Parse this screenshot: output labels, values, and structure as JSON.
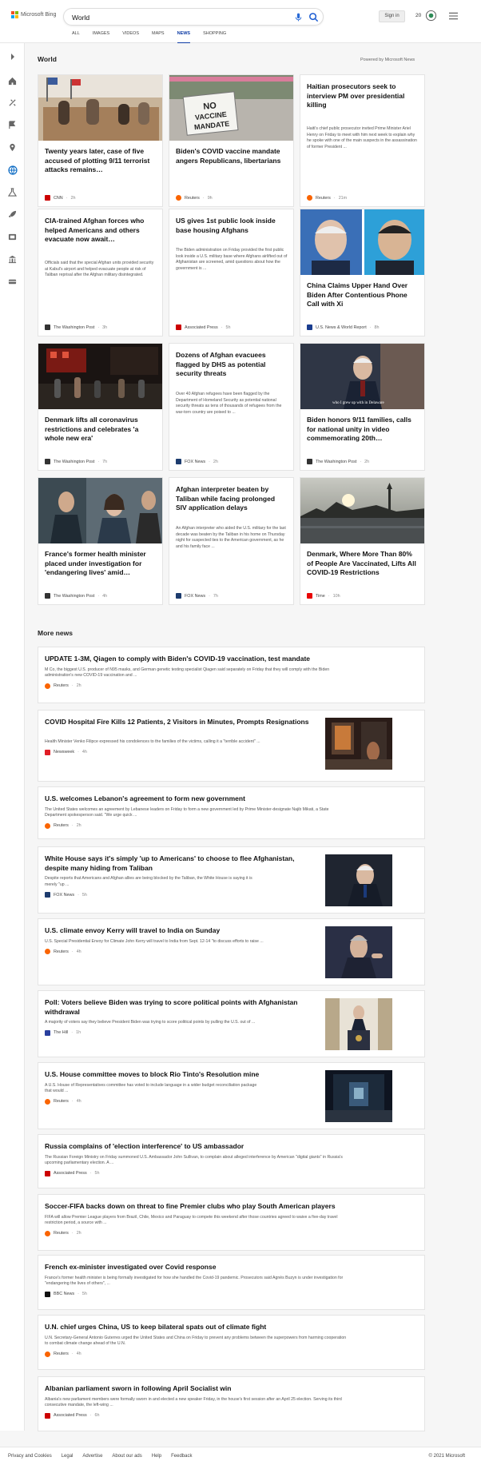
{
  "header": {
    "logo": "Microsoft Bing",
    "search_value": "World",
    "signin": "Sign in",
    "points": "20"
  },
  "nav": [
    "ALL",
    "IMAGES",
    "VIDEOS",
    "MAPS",
    "NEWS",
    "SHOPPING"
  ],
  "section_title": "World",
  "powered_by": "Powered by Microsoft News",
  "cards": [
    {
      "title": "Twenty years later, case of five accused of plotting 9/11 terrorist attacks remains…",
      "source": "CNN",
      "time": "2h",
      "logo_color": "#cc0000"
    },
    {
      "title": "Biden's COVID vaccine mandate angers Republicans, libertarians",
      "source": "Reuters",
      "time": "9h",
      "logo_color": "#fa6400"
    },
    {
      "title": "Haitian prosecutors seek to interview PM over presidential killing",
      "abstract": "Haiti's chief public prosecutor invited Prime Minister Ariel Henry on Friday to meet with him next week to explain why he spoke with one of the main suspects in the assassination of former President ...",
      "source": "Reuters",
      "time": "21m",
      "logo_color": "#fa6400"
    },
    {
      "title": "CIA-trained Afghan forces who helped Americans and others evacuate now await…",
      "abstract": "Officials said that the special Afghan units provided security at Kabul's airport and helped evacuate people at risk of Taliban reprisal after the Afghan military disintegrated.",
      "source": "The Washington Post",
      "time": "3h",
      "logo_color": "#333333"
    },
    {
      "title": "US gives 1st public look inside base housing Afghans",
      "abstract": "The Biden administration on Friday provided the first public look inside a U.S. military base where Afghans airlifted out of Afghanistan are screened, amid questions about how the government is ...",
      "source": "Associated Press",
      "time": "5h",
      "logo_color": "#cc0000"
    },
    {
      "title": "China Claims Upper Hand Over Biden After Contentious Phone Call with Xi",
      "source": "U.S. News & World Report",
      "time": "8h",
      "logo_color": "#1a3d8f"
    },
    {
      "title": "Denmark lifts all coronavirus restrictions and celebrates 'a whole new era'",
      "source": "The Washington Post",
      "time": "7h",
      "logo_color": "#333333"
    },
    {
      "title": "Dozens of Afghan evacuees flagged by DHS as potential security threats",
      "abstract": "Over 40 Afghan refugees have been flagged by the Department of Homeland Security as potential national security threats as tens of thousands of refugees from the war-torn country are poised to ...",
      "source": "FOX News",
      "time": "2h",
      "logo_color": "#1d3c6e"
    },
    {
      "title": "Biden honors 9/11 families, calls for national unity in video commemorating 20th…",
      "photo_caption": "who I grew up with in Delaware",
      "source": "The Washington Post",
      "time": "2h",
      "logo_color": "#333333"
    },
    {
      "title": "France's former health minister placed under investigation for 'endangering lives' amid…",
      "source": "The Washington Post",
      "time": "4h",
      "logo_color": "#333333"
    },
    {
      "title": "Afghan interpreter beaten by Taliban while facing prolonged SIV application delays",
      "abstract": "An Afghan interpreter who aided the U.S. military for the last decade was beaten by the Taliban in his home on Thursday night for suspected ties to the American government, as he and his family face ...",
      "source": "FOX News",
      "time": "7h",
      "logo_color": "#1d3c6e"
    },
    {
      "title": "Denmark, Where More Than 80% of People Are Vaccinated, Lifts All COVID-19 Restrictions",
      "source": "Time",
      "time": "10h",
      "logo_color": "#e90606"
    }
  ],
  "more_news_title": "More news",
  "more_news": [
    {
      "title": "UPDATE 1-3M, Qiagen to comply with Biden's COVID-19 vaccination, test mandate",
      "abstract": [
        "M Co, the biggest U.S. producer of N95 masks, and German genetic testing specialist Qiagen said separately on Friday that they will comply with the Biden",
        "administration's new COVID-19 vaccination and ..."
      ],
      "source": "Reuters",
      "time": "2h",
      "logo_color": "#fa6400"
    },
    {
      "title": "COVID Hospital Fire Kills 12 Patients, 2 Visitors in Minutes, Prompts Resignations",
      "abstract": [
        "Health Minister Venko Filipce expressed his condolences to the families of the victims, calling it a \"terrible accident\" ..."
      ],
      "source": "Newsweek",
      "time": "4h",
      "logo_color": "#e01e26"
    },
    {
      "title": "U.S. welcomes Lebanon's agreement to form new government",
      "abstract": [
        "The United States welcomes an agreement by Lebanese leaders on Friday to form a new government led by Prime Minister-designate Najib Mikati, a State",
        "Department spokesperson said. \"We urge quick ..."
      ],
      "source": "Reuters",
      "time": "2h",
      "logo_color": "#fa6400"
    },
    {
      "title": "White House says it's simply 'up to Americans' to choose to flee Afghanistan, despite many hiding from Taliban",
      "abstract": [
        "Despite reports that Americans and Afghan allies are being blocked by the Taliban, the White House is saying it is",
        "merely \"up ..."
      ],
      "source": "FOX News",
      "time": "5h",
      "logo_color": "#1d3c6e"
    },
    {
      "title": "U.S. climate envoy Kerry will travel to India on Sunday",
      "abstract": [
        "U.S. Special Presidential Envoy for Climate John Kerry will travel to India from Sept. 12-14 \"to discuss efforts to raise ..."
      ],
      "source": "Reuters",
      "time": "4h",
      "logo_color": "#fa6400"
    },
    {
      "title": "Poll: Voters believe Biden was trying to score political points with Afghanistan withdrawal",
      "abstract": [
        "A majority of voters say they believe President Biden was trying to score political points by pulling the U.S. out of ..."
      ],
      "source": "The Hill",
      "time": "1h",
      "logo_color": "#2a3f9e"
    },
    {
      "title": "U.S. House committee moves to block Rio Tinto's Resolution mine",
      "abstract": [
        "A U.S. House of Representatives committee has voted to include language in a wider budget reconciliation package",
        "that would ..."
      ],
      "source": "Reuters",
      "time": "4h",
      "logo_color": "#fa6400"
    },
    {
      "title": "Russia complains of 'election interference' to US ambassador",
      "abstract": [
        "The Russian Foreign Ministry on Friday summoned U.S. Ambassador John Sullivan, to complain about alleged interference by American \"digital giants\" in Russia's",
        "upcoming parliamentary election. A ..."
      ],
      "source": "Associated Press",
      "time": "5h",
      "logo_color": "#cc0000"
    },
    {
      "title": "Soccer-FIFA backs down on threat to fine Premier clubs who play South American players",
      "abstract": [
        "FIFA will allow Premier League players from Brazil, Chile, Mexico and Paraguay to compete this weekend after those countries agreed to waive a five-day travel",
        "restriction period, a source with ..."
      ],
      "source": "Reuters",
      "time": "2h",
      "logo_color": "#fa6400"
    },
    {
      "title": "French ex-minister investigated over Covid response",
      "abstract": [
        "France's former health minister is being formally investigated for how she handled the Covid-19 pandemic. Prosecutors said Agnès Buzyn is under investigation for",
        "\"endangering the lives of others\", ..."
      ],
      "source": "BBC News",
      "time": "5h",
      "logo_color": "#111111"
    },
    {
      "title": "U.N. chief urges China, US to keep bilateral spats out of climate fight",
      "abstract": [
        "U.N. Secretary-General Antonio Guterres urged the United States and China on Friday to prevent any problems between the superpowers from harming cooperation",
        "to combat climate change ahead of the U.N."
      ],
      "source": "Reuters",
      "time": "4h",
      "logo_color": "#fa6400"
    },
    {
      "title": "Albanian parliament sworn in following April Socialist win",
      "abstract": [
        "Albania's new parliament members were formally sworn in and elected a new speaker Friday, in the house's first session after an April 25 election. Serving its third",
        "consecutive mandate, the left-wing ..."
      ],
      "source": "Associated Press",
      "time": "6h",
      "logo_color": "#cc0000"
    }
  ],
  "footer": {
    "links": [
      "Privacy and Cookies",
      "Legal",
      "Advertise",
      "About our ads",
      "Help",
      "Feedback"
    ],
    "copyright": "© 2021 Microsoft"
  }
}
